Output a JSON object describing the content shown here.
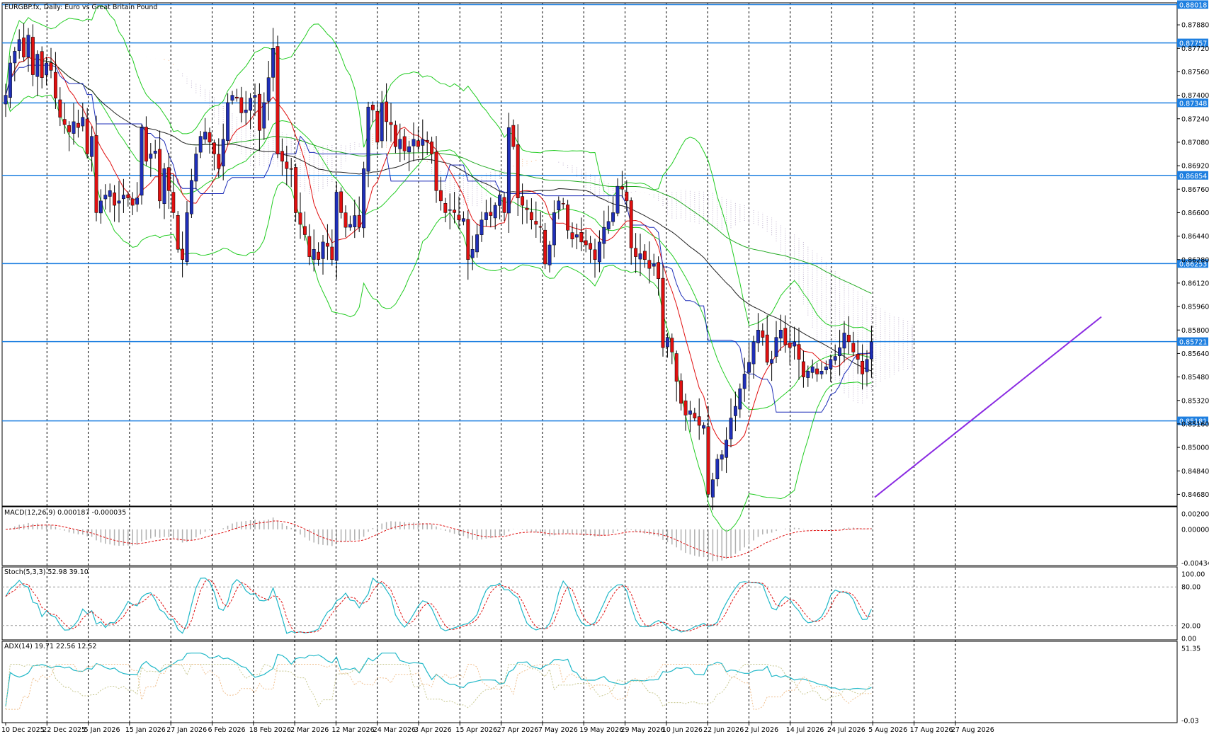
{
  "chart_data": {
    "type": "candlestick",
    "title": "EURGBP.fx, Daily:  Euro vs Great Britain Pound",
    "colors": {
      "bull": "#1f2fb8",
      "bear": "#e01010",
      "hline": "#1e7fe0",
      "trendline": "#8a2be2",
      "bollinger": "#22cc22",
      "ma_long": "#22aa22",
      "ma_mid": "#222222",
      "tenkan": "#e01010",
      "kijun": "#1f2fb8",
      "cloud_a": "#f4a76a",
      "cloud_b": "#b7a9c7",
      "macd_signal": "#e01010",
      "stoch_k": "#20b8c8",
      "stoch_d": "#e01010",
      "adx": "#20b8c8",
      "plus_di": "#c8c890",
      "minus_di": "#f0c090"
    },
    "price_axis": {
      "ticks": [
        "0.87880",
        "0.87720",
        "0.87560",
        "0.87400",
        "0.87240",
        "0.87080",
        "0.86920",
        "0.86760",
        "0.86600",
        "0.86440",
        "0.86280",
        "0.86120",
        "0.85960",
        "0.85800",
        "0.85640",
        "0.85480",
        "0.85320",
        "0.85160",
        "0.85000",
        "0.84840",
        "0.84680"
      ],
      "range": [
        0.846,
        0.8803
      ]
    },
    "horizontal_levels": [
      {
        "label": "0.88018",
        "value": 0.88018
      },
      {
        "label": "0.87757",
        "value": 0.87757
      },
      {
        "label": "0.87348",
        "value": 0.87348
      },
      {
        "label": "0.86854",
        "value": 0.86854
      },
      {
        "label": "0.86253",
        "value": 0.86253
      },
      {
        "label": "0.85721",
        "value": 0.85721
      },
      {
        "label": "0.85181",
        "value": 0.85181
      }
    ],
    "trendline": {
      "from": {
        "date": "14 Jul 2026",
        "price": 0.8466
      },
      "to": {
        "date": "1 Sep 2026",
        "price": 0.8589
      }
    },
    "x_labels": [
      "10 Dec 2025",
      "22 Dec 2025",
      "5 Jan 2026",
      "15 Jan 2026",
      "27 Jan 2026",
      "6 Feb 2026",
      "18 Feb 2026",
      "2 Mar 2026",
      "12 Mar 2026",
      "24 Mar 2026",
      "3 Apr 2026",
      "15 Apr 2026",
      "27 Apr 2026",
      "7 May 2026",
      "19 May 2026",
      "29 May 2026",
      "10 Jun 2026",
      "22 Jun 2026",
      "2 Jul 2026",
      "14 Jul 2026",
      "24 Jul 2026",
      "5 Aug 2026",
      "17 Aug 2026",
      "27 Aug 2026"
    ],
    "closes": [
      0.874,
      0.8762,
      0.877,
      0.8778,
      0.8766,
      0.8781,
      0.8754,
      0.8768,
      0.8752,
      0.8762,
      0.8757,
      0.8738,
      0.8725,
      0.872,
      0.8715,
      0.8722,
      0.8718,
      0.8725,
      0.87,
      0.8712,
      0.866,
      0.8668,
      0.8672,
      0.8675,
      0.8665,
      0.8668,
      0.8672,
      0.867,
      0.8665,
      0.867,
      0.8718,
      0.8695,
      0.87,
      0.8702,
      0.8668,
      0.869,
      0.8675,
      0.866,
      0.8635,
      0.8628,
      0.866,
      0.8682,
      0.87,
      0.8712,
      0.8715,
      0.8708,
      0.87,
      0.869,
      0.871,
      0.8735,
      0.874,
      0.8738,
      0.8728,
      0.873,
      0.8738,
      0.874,
      0.8716,
      0.8735,
      0.8752,
      0.8772,
      0.87,
      0.8695,
      0.869,
      0.869,
      0.866,
      0.8652,
      0.8645,
      0.863,
      0.8635,
      0.8628,
      0.864,
      0.8637,
      0.8628,
      0.8674,
      0.866,
      0.865,
      0.8652,
      0.8658,
      0.865,
      0.869,
      0.8732,
      0.873,
      0.8708,
      0.8735,
      0.8722,
      0.872,
      0.8705,
      0.871,
      0.8702,
      0.8705,
      0.871,
      0.8705,
      0.871,
      0.8708,
      0.87,
      0.8675,
      0.8668,
      0.866,
      0.8662,
      0.866,
      0.8655,
      0.8656,
      0.8628,
      0.8635,
      0.8645,
      0.8655,
      0.866,
      0.8658,
      0.8665,
      0.8672,
      0.866,
      0.8718,
      0.8705,
      0.867,
      0.8665,
      0.8662,
      0.8655,
      0.8652,
      0.865,
      0.8625,
      0.8638,
      0.866,
      0.8668,
      0.8666,
      0.8648,
      0.8642,
      0.8645,
      0.864,
      0.8638,
      0.8635,
      0.8628,
      0.864,
      0.865,
      0.8654,
      0.866,
      0.8678,
      0.8676,
      0.8668,
      0.8636,
      0.863,
      0.8632,
      0.8628,
      0.8622,
      0.8625,
      0.8615,
      0.8568,
      0.8575,
      0.8565,
      0.8545,
      0.853,
      0.8522,
      0.8525,
      0.852,
      0.8515,
      0.8515,
      0.8468,
      0.8478,
      0.8492,
      0.8495,
      0.8505,
      0.852,
      0.8528,
      0.854,
      0.855,
      0.8558,
      0.8572,
      0.858,
      0.8575,
      0.8558,
      0.856,
      0.8575,
      0.858,
      0.857,
      0.8568,
      0.8572,
      0.856,
      0.8548,
      0.8552,
      0.8555,
      0.855,
      0.8552,
      0.8555,
      0.856,
      0.8562,
      0.8568,
      0.8578,
      0.8572,
      0.8565,
      0.856,
      0.855,
      0.856,
      0.8572
    ]
  },
  "indicators": {
    "macd": {
      "label": "MACD(12,26,9) 0.000187 -0.000035",
      "axis": [
        "0.002001",
        "0.000000",
        "-0.004345"
      ]
    },
    "stoch": {
      "label": "Stoch(5,3,3) 52.98 39.10",
      "axis": [
        "100.00",
        "80.00",
        "20.00",
        "0.00"
      ]
    },
    "adx": {
      "label": "ADX(14) 19.71 22.56 12.52",
      "axis": [
        "51.35",
        "-0.03"
      ]
    }
  }
}
